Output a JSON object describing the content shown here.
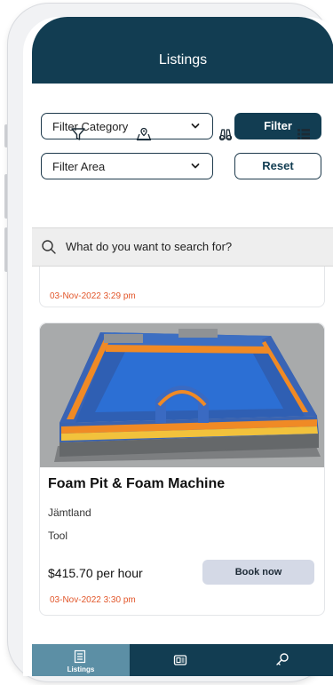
{
  "header": {
    "title": "Listings"
  },
  "filters": {
    "category_label": "Filter Category",
    "area_label": "Filter Area",
    "filter_button": "Filter",
    "reset_button": "Reset"
  },
  "view_icons": [
    "filter-icon",
    "map-icon",
    "binoculars-icon",
    "list-view-icon"
  ],
  "search": {
    "placeholder": "What do you want to search for?"
  },
  "listings": [
    {
      "date": "03-Nov-2022 3:29 pm"
    },
    {
      "title": "Foam Pit & Foam Machine",
      "area": "Jämtland",
      "category": "Tool",
      "price": "$415.70 per hour",
      "book_label": "Book now",
      "date": "03-Nov-2022 3:30 pm"
    }
  ],
  "tabbar": {
    "items": [
      {
        "label": "Listings",
        "icon": "listings-icon",
        "active": true
      },
      {
        "label": "",
        "icon": "bookings-icon",
        "active": false
      },
      {
        "label": "",
        "icon": "key-icon",
        "active": false
      }
    ]
  },
  "colors": {
    "primary": "#123d52",
    "accent_date": "#e2562a",
    "tab_active": "#5c8fa5",
    "book_button": "#d4d9e6"
  }
}
